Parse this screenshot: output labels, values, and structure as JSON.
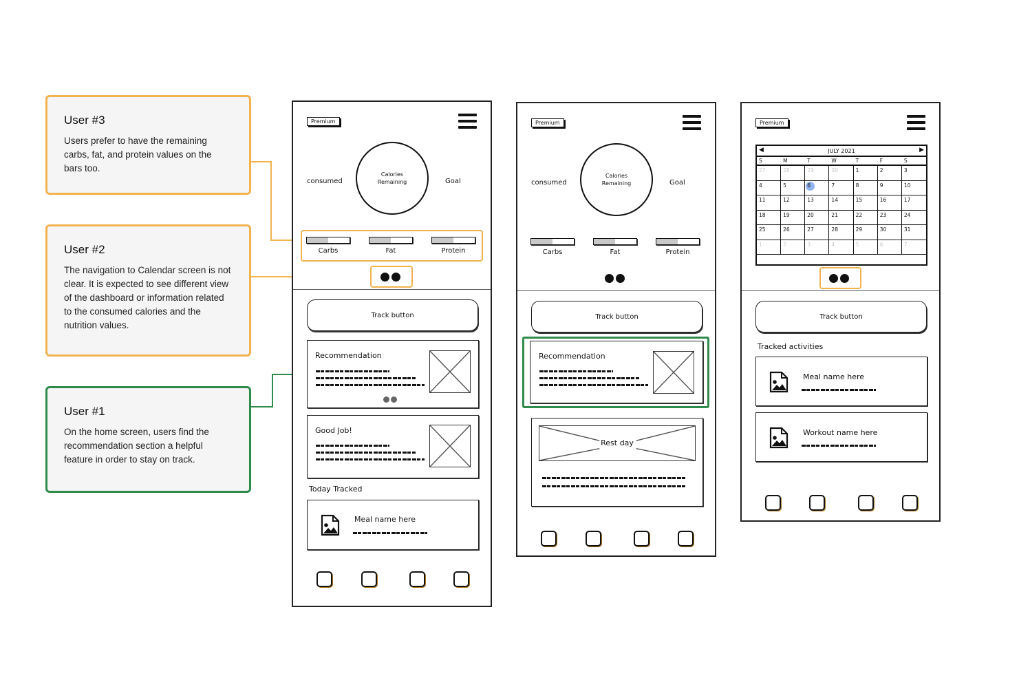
{
  "annotations": [
    {
      "id": "user3",
      "title": "User #3",
      "body": "Users prefer to have the remaining carbs, fat, and protein values on the bars too.",
      "color": "#f2b24e"
    },
    {
      "id": "user2",
      "title": "User #2",
      "body": "The navigation to Calendar screen is not clear. It is expected to see different view of the dashboard or information related to the consumed calories and the nutrition values.",
      "color": "#f2b24e"
    },
    {
      "id": "user1",
      "title": "User #1",
      "body": "On the home screen, users find the recommendation section a helpful feature in order to stay on track.",
      "color": "#2e8b4a"
    }
  ],
  "common": {
    "premium_label": "Premium",
    "consumed_label": "consumed",
    "goal_label": "Goal",
    "ring_line1": "Calories",
    "ring_line2": "Remaining",
    "macros": [
      {
        "label": "Carbs",
        "fill": 0.5
      },
      {
        "label": "Fat",
        "fill": 0.5
      },
      {
        "label": "Protein",
        "fill": 0.5
      }
    ],
    "track_button": "Track button"
  },
  "screen1": {
    "recommendation_title": "Recommendation",
    "goodjob_title": "Good Job!",
    "section_label": "Today Tracked",
    "meal_title": "Meal name here"
  },
  "screen2": {
    "recommendation_title": "Recommendation",
    "restday_label": "Rest day"
  },
  "screen3": {
    "calendar": {
      "month_label": "JULY 2021",
      "weekdays": [
        "S",
        "M",
        "T",
        "W",
        "T",
        "F",
        "S"
      ],
      "selected_day": "6",
      "weeks": [
        [
          {
            "d": "27",
            "m": true
          },
          {
            "d": "28",
            "m": true
          },
          {
            "d": "29",
            "m": true
          },
          {
            "d": "30",
            "m": true
          },
          {
            "d": "1"
          },
          {
            "d": "2"
          },
          {
            "d": "3"
          }
        ],
        [
          {
            "d": "4"
          },
          {
            "d": "5"
          },
          {
            "d": "6",
            "sel": true
          },
          {
            "d": "7"
          },
          {
            "d": "8"
          },
          {
            "d": "9"
          },
          {
            "d": "10"
          }
        ],
        [
          {
            "d": "11"
          },
          {
            "d": "12"
          },
          {
            "d": "13"
          },
          {
            "d": "14"
          },
          {
            "d": "15"
          },
          {
            "d": "16"
          },
          {
            "d": "17"
          }
        ],
        [
          {
            "d": "18"
          },
          {
            "d": "19"
          },
          {
            "d": "20"
          },
          {
            "d": "21"
          },
          {
            "d": "22"
          },
          {
            "d": "23"
          },
          {
            "d": "24"
          }
        ],
        [
          {
            "d": "25"
          },
          {
            "d": "26"
          },
          {
            "d": "27"
          },
          {
            "d": "28"
          },
          {
            "d": "29"
          },
          {
            "d": "30"
          },
          {
            "d": "31"
          }
        ],
        [
          {
            "d": "1",
            "m": true
          },
          {
            "d": "2",
            "m": true
          },
          {
            "d": "3",
            "m": true
          },
          {
            "d": "4",
            "m": true
          },
          {
            "d": "5",
            "m": true
          },
          {
            "d": "6",
            "m": true
          },
          {
            "d": "7",
            "m": true
          }
        ]
      ]
    },
    "section_label": "Tracked activities",
    "meal_title": "Meal name here",
    "workout_title": "Workout name here"
  },
  "icons": {
    "menu": "hamburger-icon",
    "image": "image-file-icon",
    "placeholder": "image-placeholder-icon",
    "nav": "nav-tab-icon",
    "prev": "◀",
    "next": "▶"
  }
}
